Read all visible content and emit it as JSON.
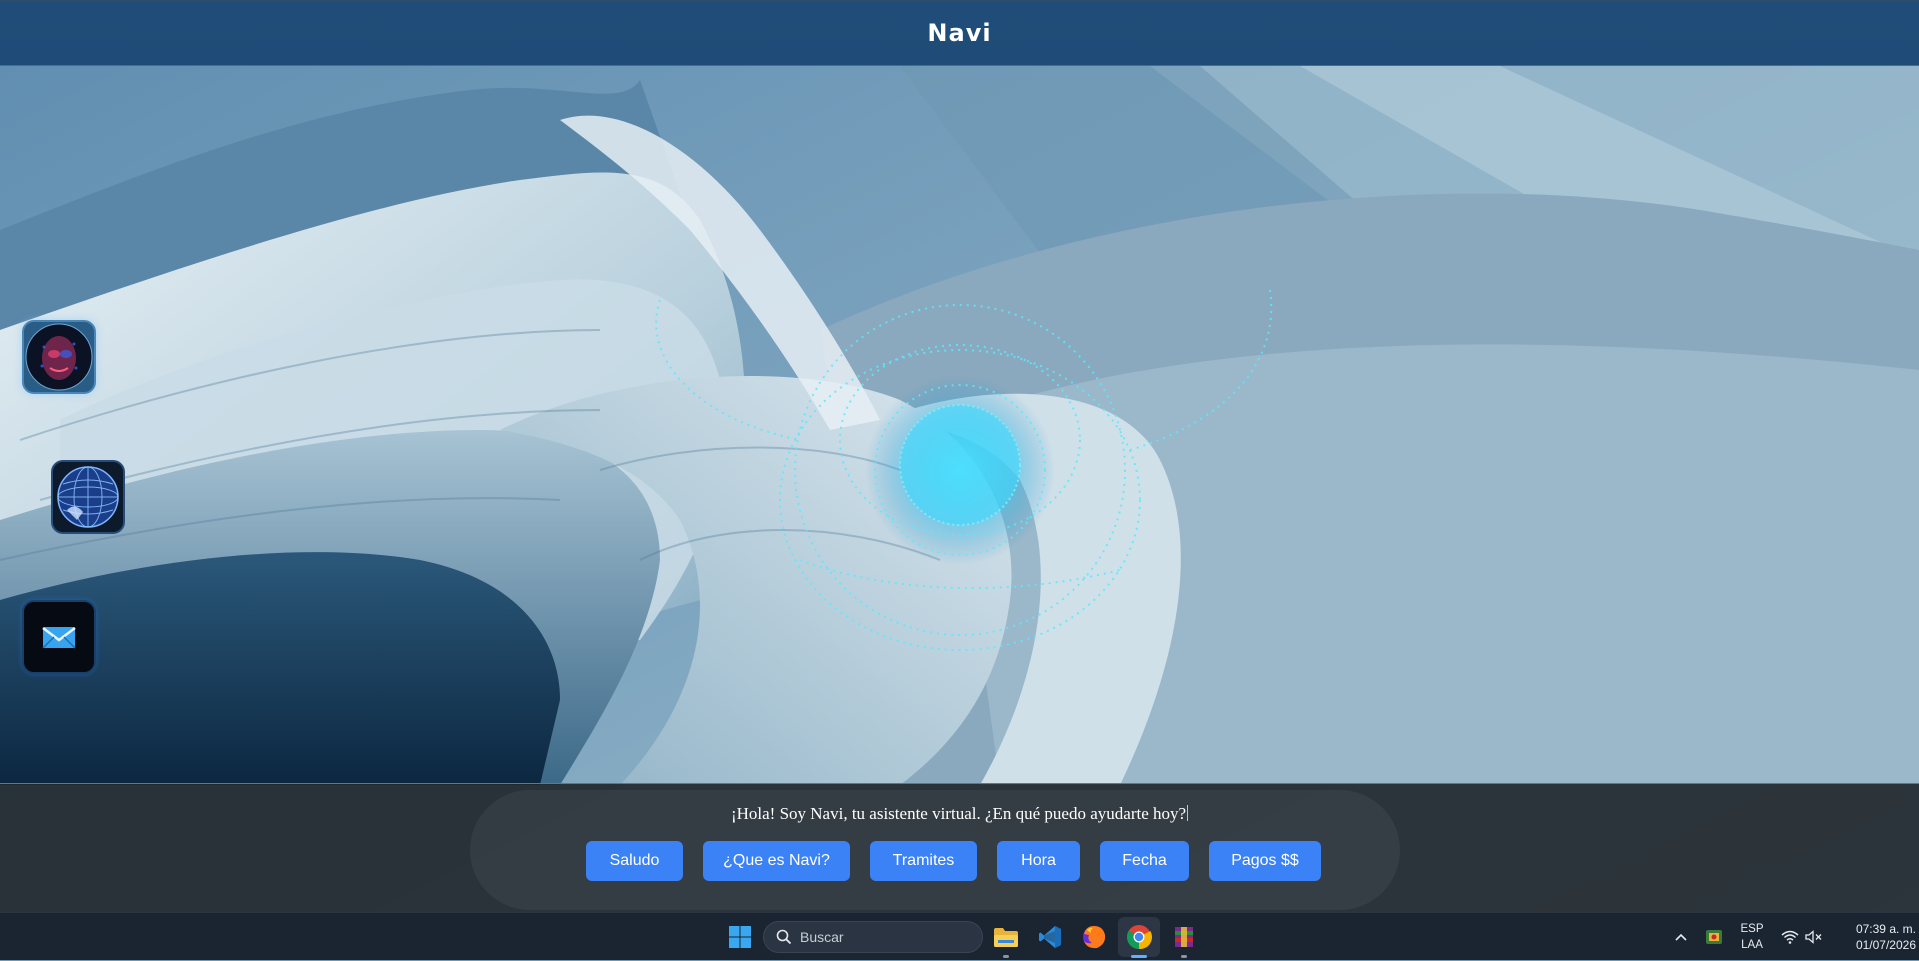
{
  "header": {
    "title": "Navi"
  },
  "side_buttons": [
    {
      "name": "avatar-button",
      "icon": "hologram-face-icon"
    },
    {
      "name": "globe-button",
      "icon": "digital-globe-icon"
    },
    {
      "name": "mail-button",
      "icon": "mail-icon"
    }
  ],
  "chat": {
    "message": "¡Hola! Soy Navi, tu asistente virtual. ¿En qué puedo ayudarte hoy?",
    "quick_replies": [
      "Saludo",
      "¿Que es Navi?",
      "Tramites",
      "Hora",
      "Fecha",
      "Pagos $$"
    ]
  },
  "taskbar": {
    "search_placeholder": "Buscar",
    "apps": [
      "windows-start-icon",
      "file-explorer-icon",
      "vscode-icon",
      "firefox-icon",
      "chrome-icon",
      "winrar-icon"
    ],
    "tray": {
      "language_top": "ESP",
      "language_bottom": "LAA",
      "time": "07:39 a. m.",
      "date": "01/07/2026"
    }
  },
  "colors": {
    "header_bg": "#204c79",
    "button_blue": "#3b82f6",
    "panel_bg": "#22282e",
    "accent_cyan": "#38e0ff"
  }
}
